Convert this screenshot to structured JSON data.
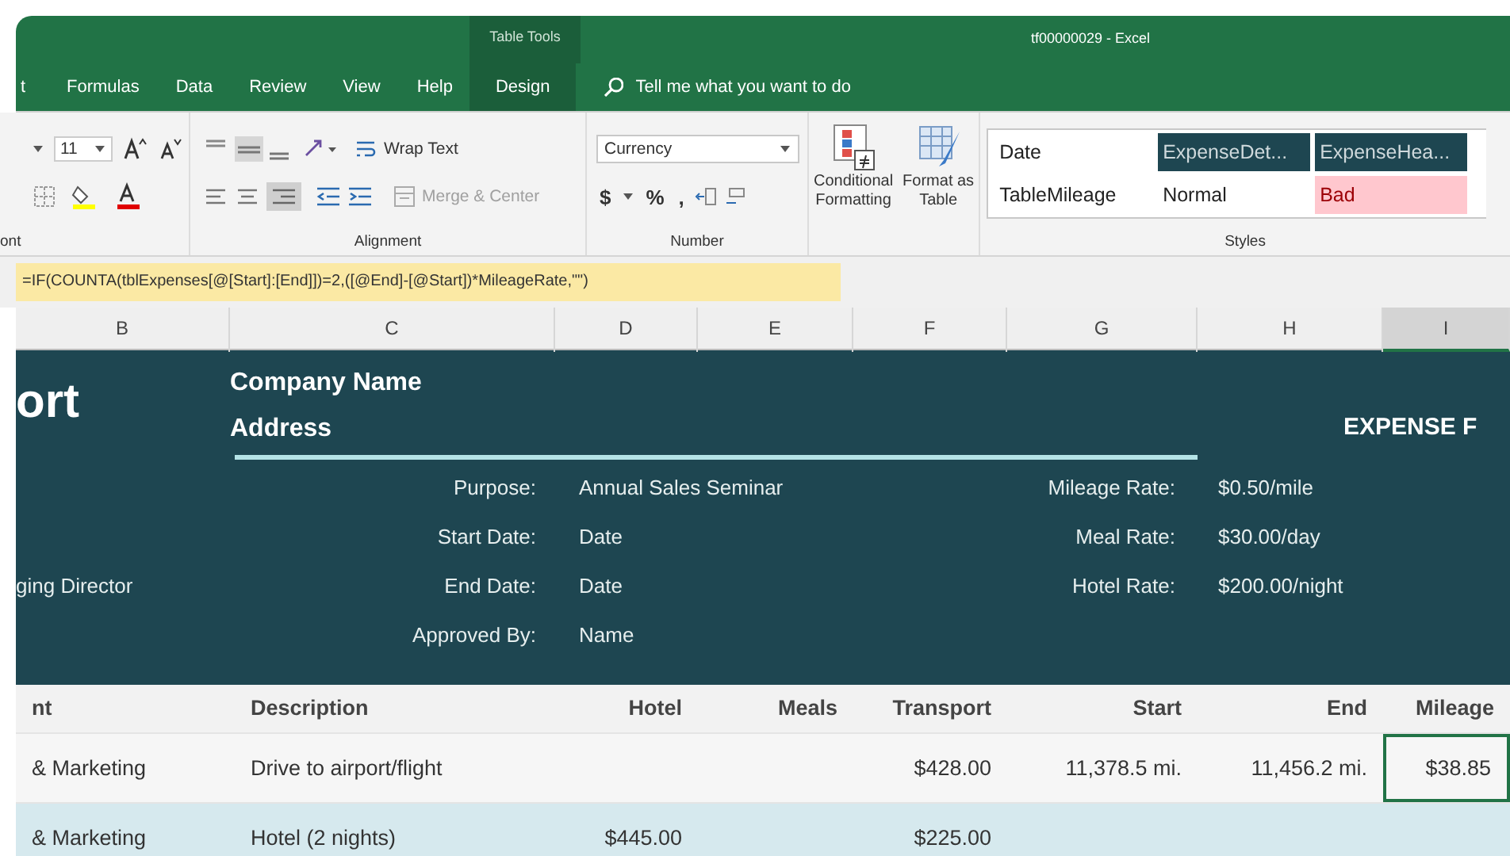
{
  "window": {
    "title": "tf00000029  -  Excel",
    "context_label": "Table Tools"
  },
  "tabs": [
    {
      "label": "t",
      "selected": false
    },
    {
      "label": "Formulas",
      "selected": false
    },
    {
      "label": "Data",
      "selected": false
    },
    {
      "label": "Review",
      "selected": false
    },
    {
      "label": "View",
      "selected": false
    },
    {
      "label": "Help",
      "selected": false
    },
    {
      "label": "Design",
      "selected": true
    }
  ],
  "tell_me": {
    "placeholder": "Tell me what you want to do"
  },
  "ribbon": {
    "font": {
      "size": "11",
      "label": "ont"
    },
    "alignment": {
      "wrap_text": "Wrap Text",
      "merge": {
        "label": "Merge & Center",
        "disabled": true
      },
      "label": "Alignment"
    },
    "number": {
      "format": "Currency",
      "currency": "$",
      "percent": "%",
      "comma": ",",
      "label": "Number"
    },
    "conditional_formatting": [
      "Conditional",
      "Formatting"
    ],
    "format_as_table": [
      "Format as",
      "Table"
    ],
    "styles": {
      "items": [
        {
          "label": "Date",
          "kind": "plain"
        },
        {
          "label": "ExpenseDet...",
          "kind": "dark"
        },
        {
          "label": "ExpenseHea...",
          "kind": "dark"
        },
        {
          "label": "TableMileage",
          "kind": "plain"
        },
        {
          "label": "Normal",
          "kind": "plain"
        },
        {
          "label": "Bad",
          "kind": "bad"
        }
      ],
      "label": "Styles"
    }
  },
  "formula_bar": {
    "value": "=IF(COUNTA(tblExpenses[@[Start]:[End]])=2,([@End]-[@Start])*MileageRate,\"\")"
  },
  "columns": [
    {
      "label": "B",
      "selected": false
    },
    {
      "label": "C",
      "selected": false
    },
    {
      "label": "D",
      "selected": false
    },
    {
      "label": "E",
      "selected": false
    },
    {
      "label": "F",
      "selected": false
    },
    {
      "label": "G",
      "selected": false
    },
    {
      "label": "H",
      "selected": false
    },
    {
      "label": "I",
      "selected": true
    }
  ],
  "report": {
    "title": "ort",
    "company": "Company Name",
    "address": "Address",
    "banner": "EXPENSE F",
    "employee_title": "ging Director",
    "fields": [
      {
        "label": "Purpose:",
        "value": "Annual Sales Seminar"
      },
      {
        "label": "Start Date:",
        "value": "Date"
      },
      {
        "label": "End Date:",
        "value": "Date"
      },
      {
        "label": "Approved By:",
        "value": "Name"
      }
    ],
    "rates": [
      {
        "label": "Mileage Rate:",
        "value": "$0.50/mile"
      },
      {
        "label": "Meal Rate:",
        "value": "$30.00/day"
      },
      {
        "label": "Hotel Rate:",
        "value": "$200.00/night"
      }
    ]
  },
  "table": {
    "columns": [
      "nt",
      "Description",
      "Hotel",
      "Meals",
      "Transport",
      "Start",
      "End",
      "Mileage"
    ],
    "rows": [
      {
        "cells": [
          {
            "text": "& Marketing",
            "selected": false
          },
          {
            "text": "Drive to airport/flight",
            "selected": false
          },
          null,
          null,
          {
            "text": "$428.00",
            "selected": false
          },
          {
            "text": "11,378.5  mi.",
            "selected": false
          },
          {
            "text": "11,456.2  mi.",
            "selected": false
          },
          {
            "text": "$38.85",
            "selected": true
          }
        ]
      },
      {
        "cells": [
          {
            "text": "& Marketing",
            "selected": false
          },
          {
            "text": "Hotel (2 nights)",
            "selected": false
          },
          {
            "text": "$445.00",
            "selected": false
          },
          null,
          {
            "text": "$225.00",
            "selected": false
          },
          null,
          null,
          null
        ]
      }
    ]
  }
}
